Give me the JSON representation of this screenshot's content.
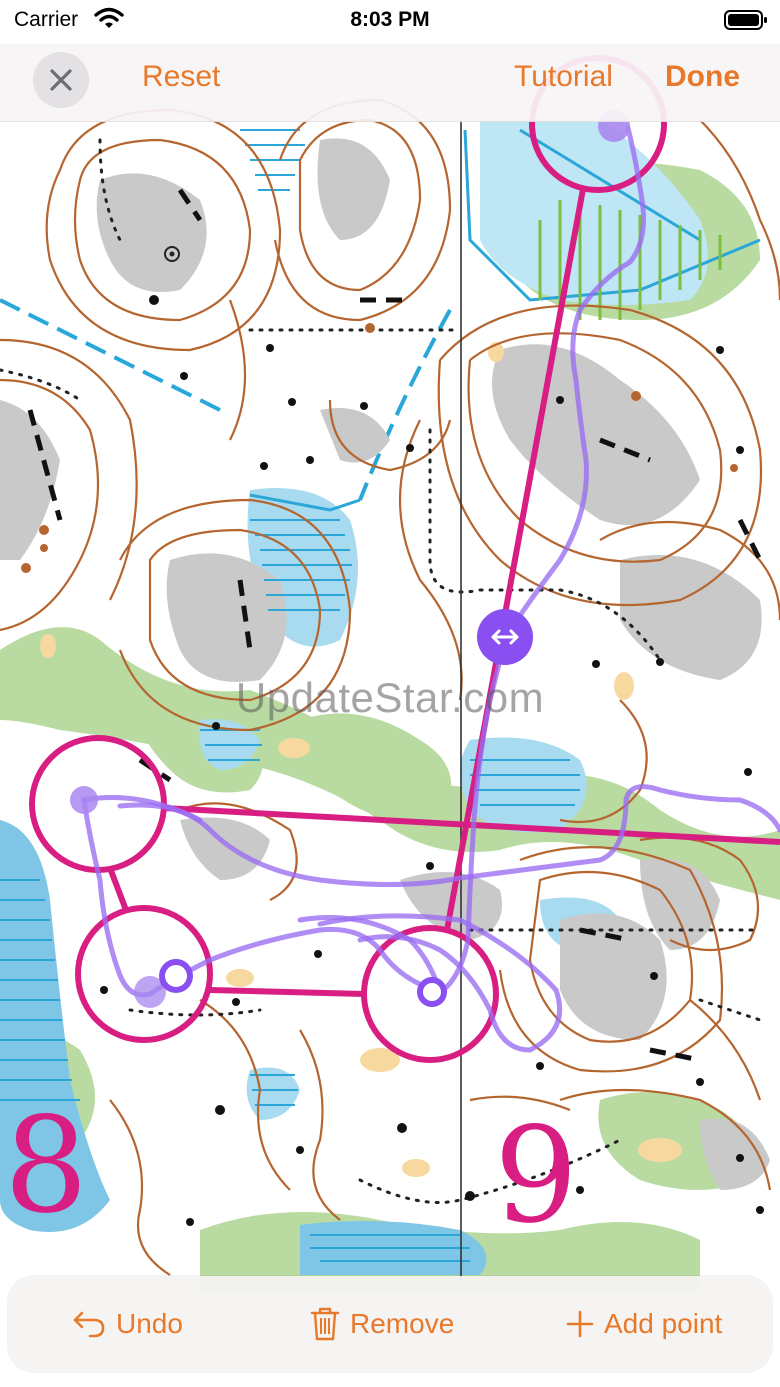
{
  "status_bar": {
    "carrier": "Carrier",
    "time": "8:03 PM"
  },
  "nav": {
    "reset_label": "Reset",
    "tutorial_label": "Tutorial",
    "done_label": "Done"
  },
  "map": {
    "watermark": "UpdateStar.com",
    "control_numbers": [
      "8",
      "9"
    ],
    "colors": {
      "course": "#d81e83",
      "route": "#9a6cf2",
      "water": "#2aa6d8",
      "vegetation": "#b9dba2",
      "contour": "#b5652f",
      "rock": "#c6c6c6"
    }
  },
  "toolbar": {
    "undo_label": "Undo",
    "remove_label": "Remove",
    "add_point_label": "Add point",
    "accent": "#e8792b"
  }
}
